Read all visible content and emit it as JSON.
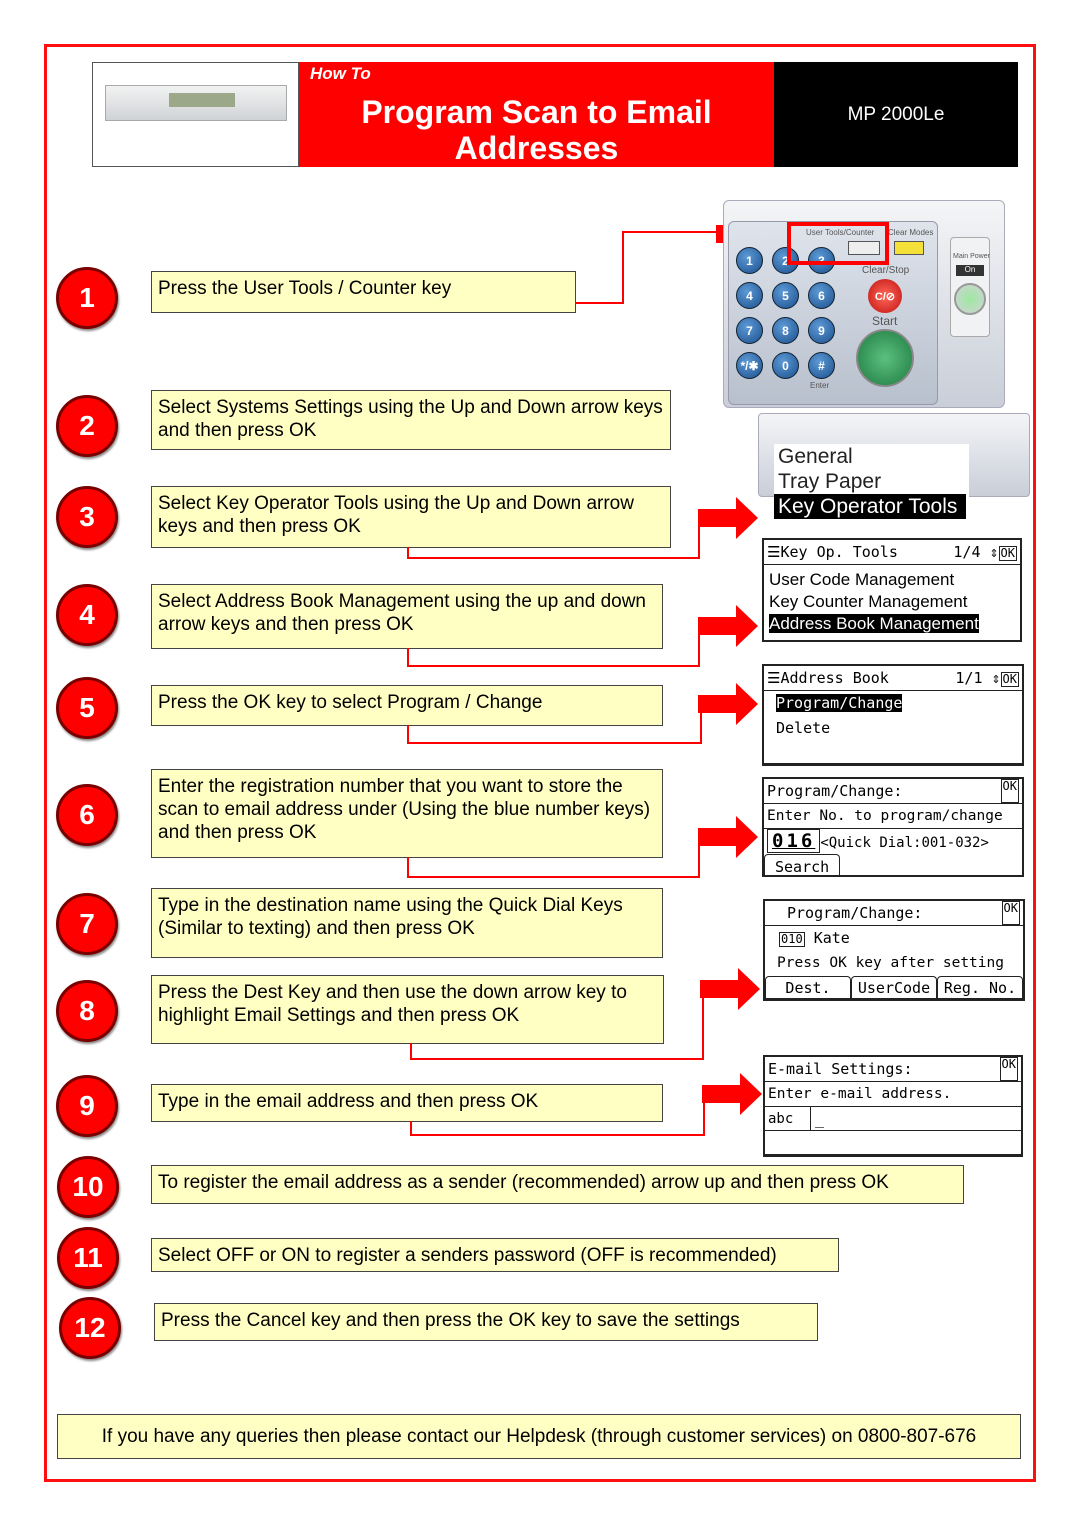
{
  "header": {
    "how_to": "How To",
    "title": "Program Scan to Email Addresses",
    "model": "MP 2000Le"
  },
  "colors": {
    "accent": "#ff0000",
    "step_box": "#ffffc4",
    "frame": "#ff1010"
  },
  "steps": [
    {
      "n": "1",
      "text": "Press the User Tools / Counter key"
    },
    {
      "n": "2",
      "text": "Select Systems Settings using the Up and Down arrow keys and then press OK"
    },
    {
      "n": "3",
      "text": "Select Key Operator Tools using the Up and Down arrow keys and then press OK"
    },
    {
      "n": "4",
      "text": "Select Address Book Management using the up and down arrow keys and then press OK"
    },
    {
      "n": "5",
      "text": "Press the OK key to select Program / Change"
    },
    {
      "n": "6",
      "text": "Enter the registration number that you want to store the scan to email address under (Using the blue number keys) and then press OK"
    },
    {
      "n": "7",
      "text": "Type in the destination name using the Quick Dial Keys (Similar to texting) and then press OK"
    },
    {
      "n": "8",
      "text": "Press the Dest Key and then use the down arrow key to highlight Email Settings and then press OK"
    },
    {
      "n": "9",
      "text": "Type in the email address and then press OK"
    },
    {
      "n": "10",
      "text": "To register the email address as a sender (recommended) arrow up and then press OK"
    },
    {
      "n": "11",
      "text": "Select OFF or ON to register a senders password (OFF is recommended)"
    },
    {
      "n": "12",
      "text": "Press the Cancel key and then press the OK key to save the settings"
    }
  ],
  "panel": {
    "user_tools": "User Tools/Counter",
    "clear_modes": "Clear Modes",
    "clear_stop": "Clear/Stop",
    "start": "Start",
    "enter": "Enter",
    "main_power": "Main Power",
    "on": "On",
    "cs": "C/⊘",
    "keys": [
      "1",
      "2",
      "3",
      "4",
      "5",
      "6",
      "7",
      "8",
      "9",
      "*/✱",
      "0",
      "#"
    ]
  },
  "screens": {
    "system": {
      "items": [
        "General",
        "Tray Paper",
        "Key Operator Tools"
      ]
    },
    "key_op": {
      "title": "Key Op. Tools",
      "page": "1/4",
      "ok": "OK",
      "items": [
        "User Code Management",
        "Key Counter Management",
        "Address Book Management"
      ]
    },
    "address_book": {
      "title": "Address Book",
      "page": "1/1",
      "ok": "OK",
      "items": [
        "Program/Change",
        "Delete"
      ]
    },
    "program_change": {
      "title": "Program/Change:",
      "ok": "OK",
      "prompt": "Enter No. to program/change",
      "number": "016",
      "range": "<Quick Dial:001-032>",
      "search": "Search"
    },
    "name": {
      "title": "Program/Change:",
      "ok": "OK",
      "reg": "010",
      "name": "Kate",
      "hint": "Press OK key after setting",
      "tabs": [
        "Dest.",
        "UserCode",
        "Reg. No."
      ]
    },
    "email": {
      "title": "E-mail Settings:",
      "ok": "OK",
      "prompt": "Enter e-mail address.",
      "mode": "abc",
      "cursor": "_"
    }
  },
  "footer": "If you have any queries then please contact our Helpdesk (through customer services) on 0800-807-676"
}
